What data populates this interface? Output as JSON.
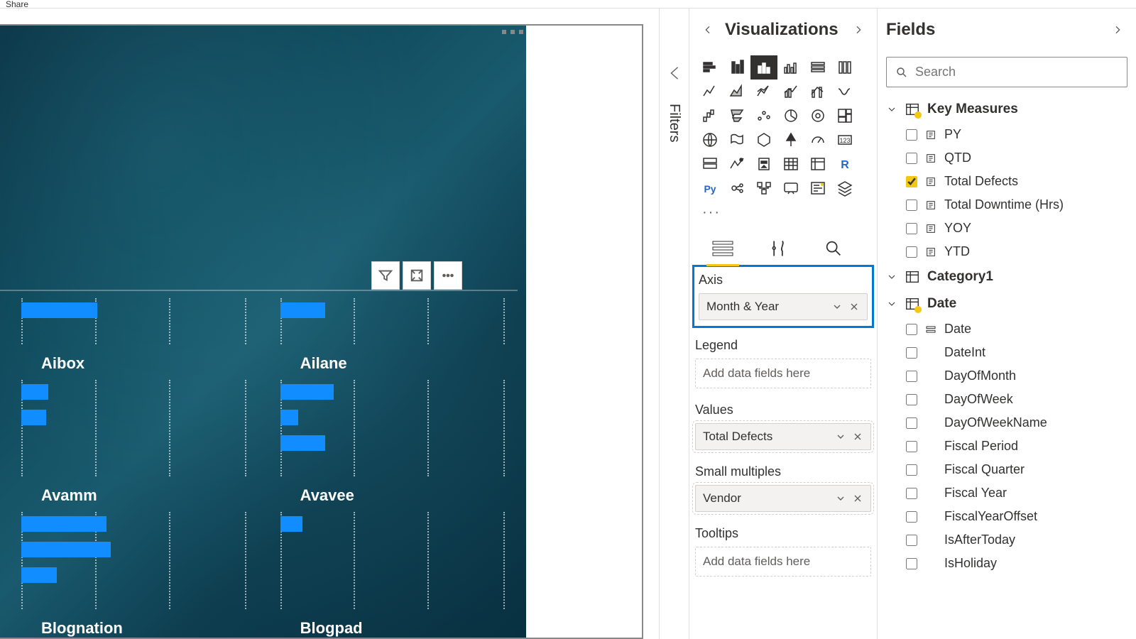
{
  "topbar": {
    "share": "Share"
  },
  "filters_rail": {
    "label": "Filters"
  },
  "viz_pane": {
    "title": "Visualizations",
    "ellipsis": "···",
    "wells": {
      "axis": {
        "label": "Axis",
        "value": "Month & Year"
      },
      "legend": {
        "label": "Legend",
        "placeholder": "Add data fields here"
      },
      "values": {
        "label": "Values",
        "value": "Total Defects"
      },
      "small_multiples": {
        "label": "Small multiples",
        "value": "Vendor"
      },
      "tooltips": {
        "label": "Tooltips",
        "placeholder": "Add data fields here"
      }
    }
  },
  "fields_pane": {
    "title": "Fields",
    "search_placeholder": "Search",
    "tables": [
      {
        "name": "Key Measures",
        "has_check": true,
        "fields": [
          {
            "name": "PY",
            "checked": false,
            "icon": "measure"
          },
          {
            "name": "QTD",
            "checked": false,
            "icon": "measure"
          },
          {
            "name": "Total Defects",
            "checked": true,
            "icon": "measure"
          },
          {
            "name": "Total Downtime (Hrs)",
            "checked": false,
            "icon": "measure"
          },
          {
            "name": "YOY",
            "checked": false,
            "icon": "measure"
          },
          {
            "name": "YTD",
            "checked": false,
            "icon": "measure"
          }
        ]
      },
      {
        "name": "Category1",
        "has_check": false,
        "fields": []
      },
      {
        "name": "Date",
        "has_check": true,
        "fields": [
          {
            "name": "Date",
            "checked": false,
            "icon": "hierarchy"
          },
          {
            "name": "DateInt",
            "checked": false,
            "icon": "none"
          },
          {
            "name": "DayOfMonth",
            "checked": false,
            "icon": "none"
          },
          {
            "name": "DayOfWeek",
            "checked": false,
            "icon": "none"
          },
          {
            "name": "DayOfWeekName",
            "checked": false,
            "icon": "none"
          },
          {
            "name": "Fiscal Period",
            "checked": false,
            "icon": "none"
          },
          {
            "name": "Fiscal Quarter",
            "checked": false,
            "icon": "none"
          },
          {
            "name": "Fiscal Year",
            "checked": false,
            "icon": "none"
          },
          {
            "name": "FiscalYearOffset",
            "checked": false,
            "icon": "none"
          },
          {
            "name": "IsAfterToday",
            "checked": false,
            "icon": "none"
          },
          {
            "name": "IsHoliday",
            "checked": false,
            "icon": "none"
          }
        ]
      }
    ]
  },
  "chart_data": {
    "type": "bar",
    "note": "small-multiples horizontal bars by Vendor; bar widths estimated from pixels (0-100 scale)",
    "multiples": [
      {
        "vendor": "Aibox",
        "values": [
          34
        ]
      },
      {
        "vendor": "Ailane",
        "values": [
          20
        ]
      },
      {
        "vendor": "Avamm",
        "values": [
          12,
          11
        ]
      },
      {
        "vendor": "Avavee",
        "values": [
          24,
          8,
          20
        ]
      },
      {
        "vendor": "Blognation",
        "values": [
          38,
          40,
          16
        ]
      },
      {
        "vendor": "Blogpad",
        "values": [
          10
        ]
      }
    ]
  }
}
